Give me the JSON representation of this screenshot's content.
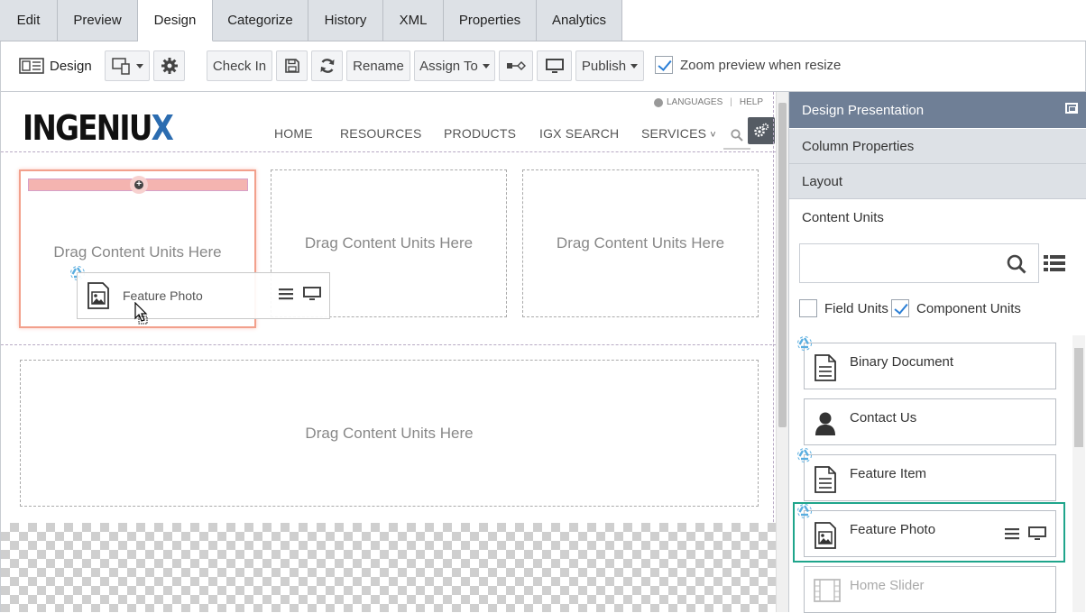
{
  "tabs": [
    {
      "label": "Edit"
    },
    {
      "label": "Preview"
    },
    {
      "label": "Design",
      "active": true
    },
    {
      "label": "Categorize"
    },
    {
      "label": "History"
    },
    {
      "label": "XML"
    },
    {
      "label": "Properties"
    },
    {
      "label": "Analytics"
    }
  ],
  "toolbar": {
    "design_label": "Design",
    "check_in": "Check In",
    "rename": "Rename",
    "assign_to": "Assign To",
    "publish": "Publish",
    "zoom_label": "Zoom preview when resize",
    "zoom_checked": true
  },
  "site": {
    "logo_main": "INGENIU",
    "logo_x": "X",
    "languages": "LANGUAGES",
    "help": "HELP",
    "separator": "|",
    "nav": [
      "HOME",
      "RESOURCES",
      "PRODUCTS",
      "IGX SEARCH",
      "SERVICES"
    ],
    "services_caret": "˅"
  },
  "canvas": {
    "drop_text": "Drag Content Units Here",
    "dragging_label": "Feature Photo"
  },
  "panel": {
    "title": "Design Presentation",
    "sections": [
      "Column Properties",
      "Layout"
    ],
    "content_units_title": "Content Units",
    "search_placeholder": "",
    "filters": {
      "field_units": "Field Units",
      "field_units_checked": false,
      "component_units": "Component Units",
      "component_units_checked": true
    },
    "units": [
      {
        "label": "Binary Document",
        "icon": "document-icon",
        "recycle": true
      },
      {
        "label": "Contact Us",
        "icon": "person-icon",
        "recycle": false
      },
      {
        "label": "Feature Item",
        "icon": "document-icon",
        "recycle": true
      },
      {
        "label": "Feature Photo",
        "icon": "image-icon",
        "recycle": true,
        "selected": true
      },
      {
        "label": "Home Slider",
        "icon": "film-icon",
        "recycle": false,
        "faded": true
      }
    ]
  },
  "colors": {
    "panel_header": "#6f7f96",
    "accordion": "#dde1e6",
    "active_drop": "#f2a08c",
    "selection": "#1fa58b",
    "checkbox": "#2b7fd6"
  }
}
